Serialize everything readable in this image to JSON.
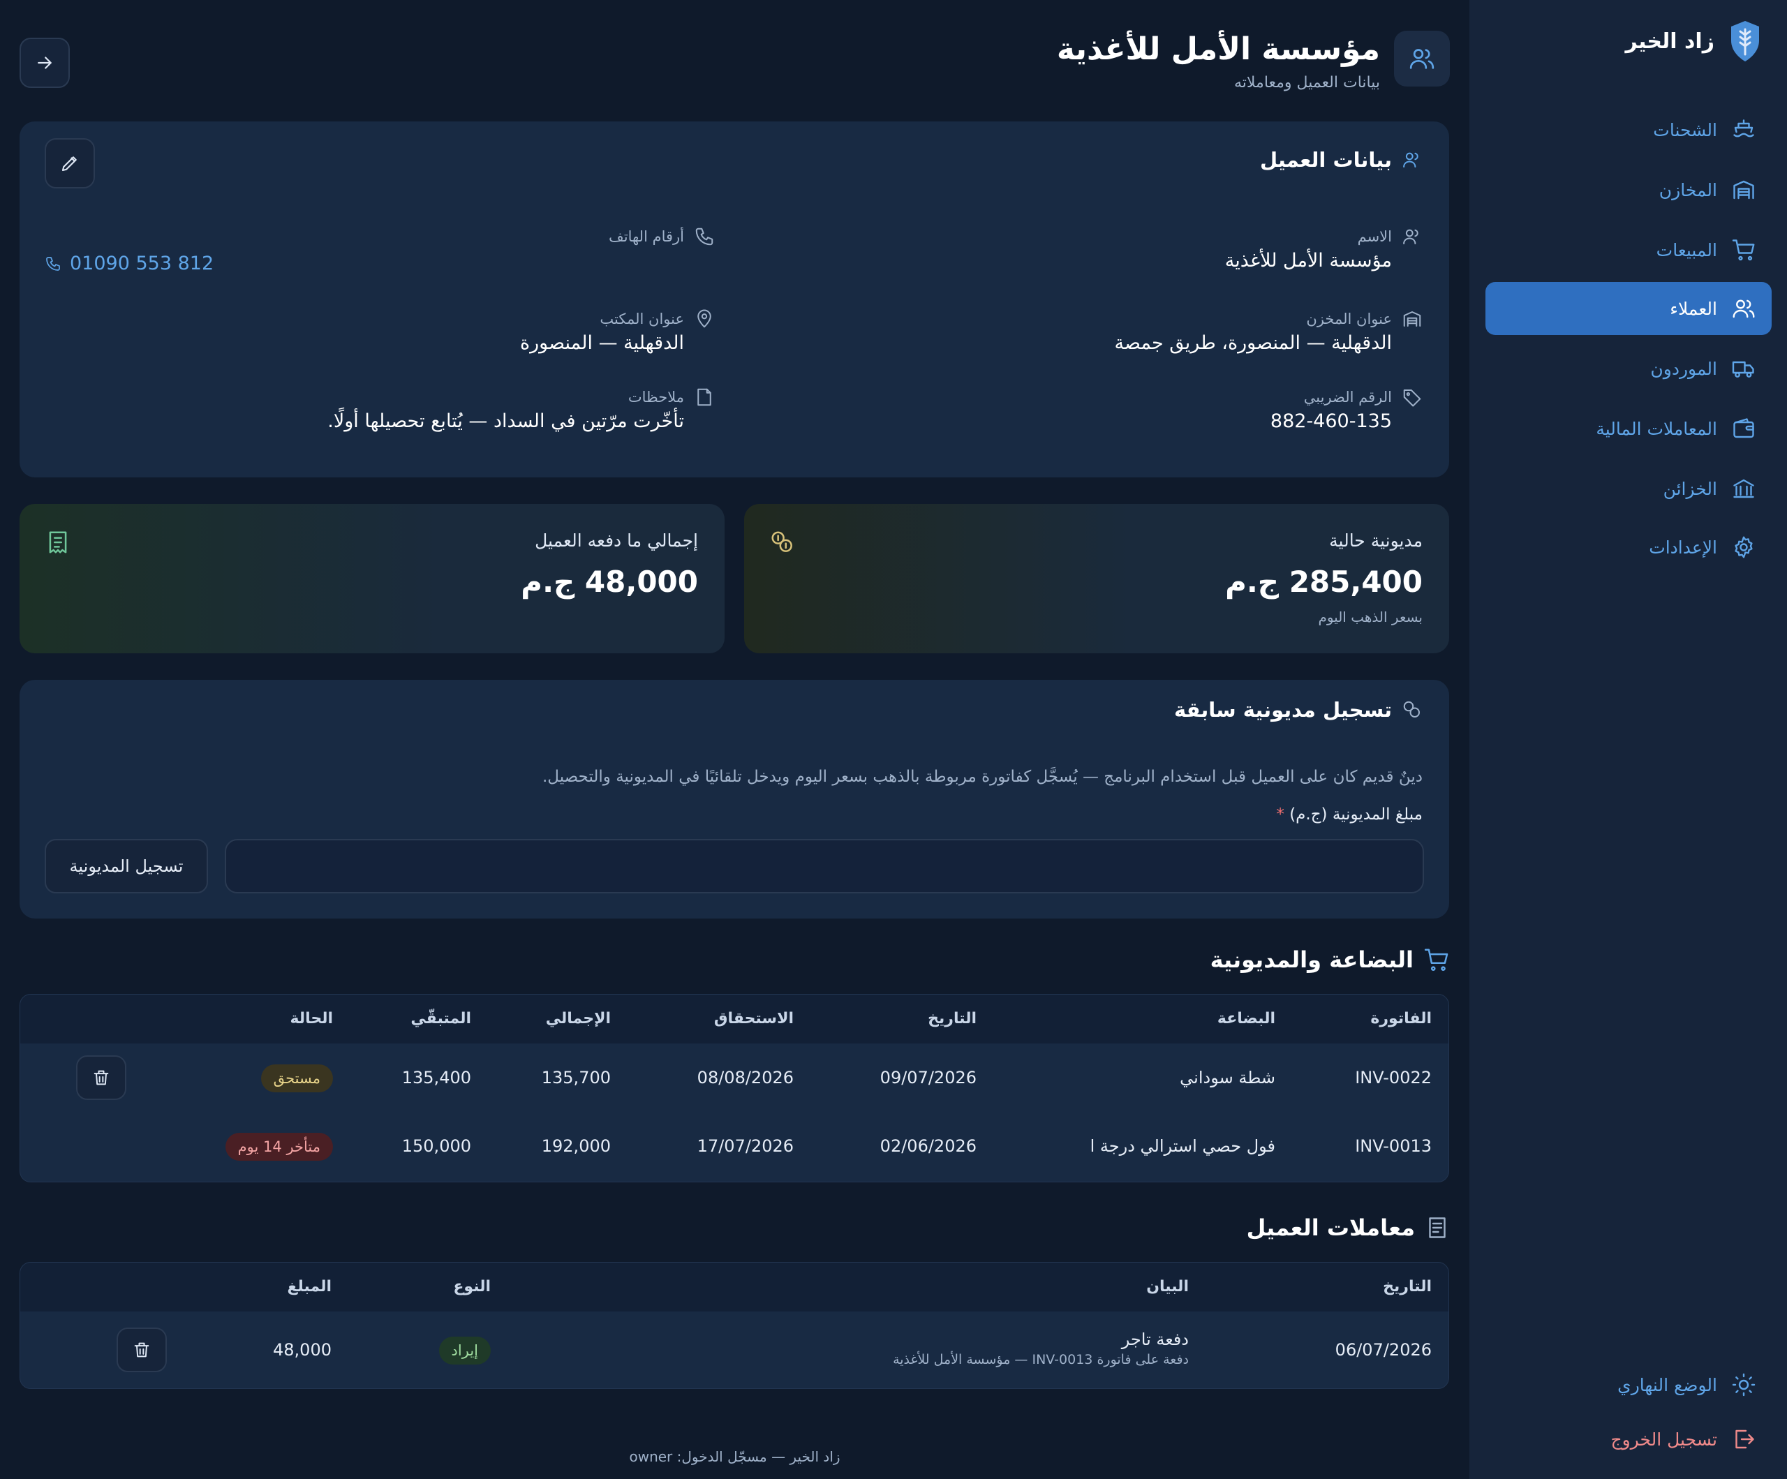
{
  "app": {
    "brand_name": "زاد الخير"
  },
  "nav": {
    "items": [
      {
        "label": "الشحنات",
        "icon": "ship-icon"
      },
      {
        "label": "المخازن",
        "icon": "warehouse-icon"
      },
      {
        "label": "المبيعات",
        "icon": "cart-icon"
      },
      {
        "label": "العملاء",
        "icon": "users-icon",
        "active": true
      },
      {
        "label": "الموردون",
        "icon": "truck-icon"
      },
      {
        "label": "المعاملات المالية",
        "icon": "wallet-icon"
      },
      {
        "label": "الخزائن",
        "icon": "bank-icon"
      },
      {
        "label": "الإعدادات",
        "icon": "settings-icon"
      }
    ],
    "day_mode": "الوضع النهاري",
    "logout": "تسجيل الخروج"
  },
  "header": {
    "title": "مؤسسة الأمل للأغذية",
    "subtitle": "بيانات العميل ومعاملاته"
  },
  "client_info": {
    "title": "بيانات العميل",
    "name_label": "الاسم",
    "name_value": "مؤسسة الأمل للأغذية",
    "phones_label": "أرقام الهاتف",
    "phone_value": "01090 553 812",
    "warehouse_label": "عنوان المخزن",
    "warehouse_value": "الدقهلية — المنصورة، طريق جمصة",
    "office_label": "عنوان المكتب",
    "office_value": "الدقهلية — المنصورة",
    "tax_label": "الرقم الضريبي",
    "tax_value": "882-460-135",
    "notes_label": "ملاحظات",
    "notes_value": "تأخّرت مرّتين في السداد — يُتابع تحصيلها أولًا."
  },
  "stats": {
    "debt_title": "مديونية حالية",
    "debt_value": "285,400 ج.م",
    "debt_sub": "بسعر الذهب اليوم",
    "paid_title": "إجمالي ما دفعه العميل",
    "paid_value": "48,000 ج.م"
  },
  "prev_debt": {
    "title": "تسجيل مديونية سابقة",
    "description": "دينٌ قديم كان على العميل قبل استخدام البرنامج — يُسجَّل كفاتورة مربوطة بالذهب بسعر اليوم ويدخل تلقائيًا في المديونية والتحصيل.",
    "amount_label": "مبلغ المديونية (ج.م)",
    "required_mark": "*",
    "amount_value": "",
    "submit_label": "تسجيل المديونية"
  },
  "goods": {
    "title": "البضاعة والمديونية",
    "headers": [
      "الفاتورة",
      "البضاعة",
      "التاريخ",
      "الاستحقاق",
      "الإجمالي",
      "المتبقّي",
      "الحالة"
    ],
    "rows": [
      {
        "invoice": "INV-0022",
        "goods": "شطة سوداني",
        "date": "09/07/2026",
        "due": "08/08/2026",
        "total": "135,700",
        "remaining": "135,400",
        "status": "مستحق",
        "status_kind": "due"
      },
      {
        "invoice": "INV-0013",
        "goods": "فول حصي استرالي درجة ا",
        "date": "02/06/2026",
        "due": "17/07/2026",
        "total": "192,000",
        "remaining": "150,000",
        "status": "متأخر 14 يوم",
        "status_kind": "late"
      }
    ]
  },
  "transactions": {
    "title": "معاملات العميل",
    "headers": [
      "التاريخ",
      "البيان",
      "النوع",
      "المبلغ"
    ],
    "rows": [
      {
        "date": "06/07/2026",
        "desc": "دفعة تاجر",
        "desc_sub": "دفعة على فاتورة INV-0013 — مؤسسة الأمل للأغذية",
        "type": "إيراد",
        "amount": "48,000"
      }
    ]
  },
  "footer": {
    "text": "زاد الخير — مسجّل الدخول: owner"
  }
}
